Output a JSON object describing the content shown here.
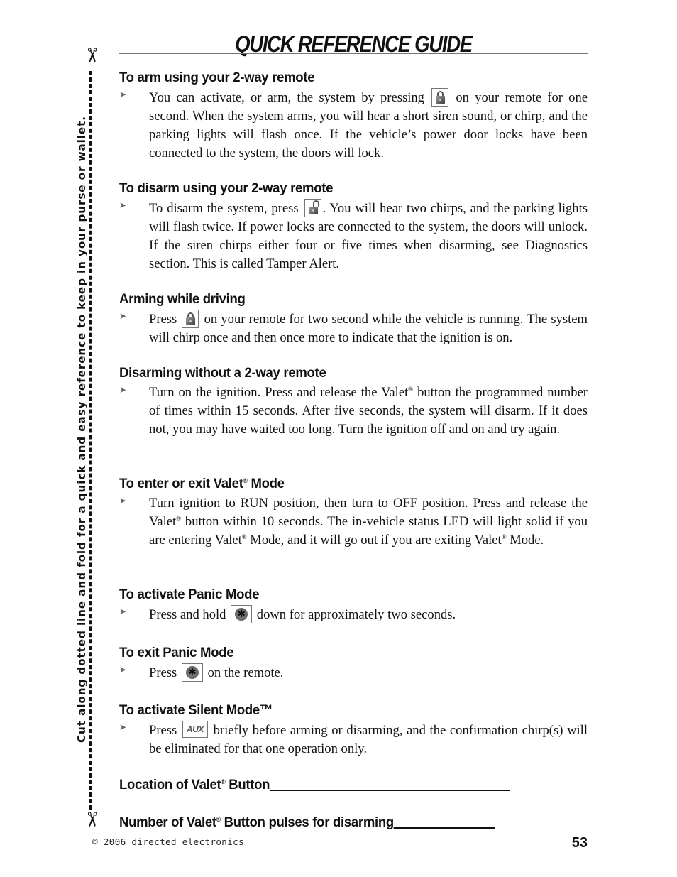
{
  "title": "QUICK REFERENCE GUIDE",
  "side_instruction": "Cut along dotted line and fold for a quick and easy reference to keep in your purse or wallet.",
  "icons": {
    "lock": "lock-button",
    "unlock": "unlock-button",
    "panic": "panic-button",
    "aux": "aux-button",
    "aux_label": "AUX",
    "scissors": "✂",
    "bullet": "➤",
    "panic_glyph": "✱",
    "registered": "®"
  },
  "sections": [
    {
      "heading": "To arm using your 2-way remote",
      "text_before": "You can activate, or arm, the system by pressing",
      "text_after": "on your remote for one second. When the system arms, you will hear a short siren sound, or chirp, and the parking lights will flash once. If the vehicle’s power door locks have been connected to the system, the doors will lock."
    },
    {
      "heading": "To disarm using your 2-way remote",
      "text_before": "To disarm the system, press",
      "text_after": ". You will hear two chirps, and the parking lights will flash twice. If power locks are connected to the system, the doors will unlock. If the siren chirps either four or five times when disarming, see Diagnostics section. This is called Tamper Alert."
    },
    {
      "heading": "Arming while driving",
      "text_before": "Press",
      "text_after": "on your remote for two second while the vehicle is running. The system will chirp once and then once more to indicate that the ignition is on."
    },
    {
      "heading": "Disarming without a 2-way remote",
      "text_a": "Turn on the ignition. Press and release the Valet",
      "text_b": " button the programmed number of times within 15 seconds. After five seconds, the system will disarm. If it does not, you may have waited too long. Turn the ignition off and on and try again."
    },
    {
      "heading_a": "To enter or exit Valet",
      "heading_b": " Mode",
      "text_a": "Turn ignition to RUN position, then turn to OFF position. Press and release the Valet",
      "text_b": " button within 10 seconds. The in-vehicle status LED will light solid if you are entering Valet",
      "text_c": " Mode, and it will go out if you are exiting Valet",
      "text_d": " Mode."
    },
    {
      "heading": "To activate Panic Mode",
      "text_before": "Press and hold",
      "text_after": "down for approximately two seconds."
    },
    {
      "heading": "To exit Panic Mode",
      "text_before": "Press",
      "text_after": "on the remote."
    },
    {
      "heading": "To activate Silent Mode™",
      "text_before": "Press",
      "text_after": "briefly before arming or disarming, and the confirmation chirp(s) will be eliminated for that one operation only."
    }
  ],
  "fill_in": [
    {
      "label_a": "Location of Valet",
      "label_b": " Button",
      "value": ""
    },
    {
      "label_a": "Number of Valet",
      "label_b": " Button pulses for disarming",
      "value": ""
    }
  ],
  "footer": {
    "copyright": "© 2006 directed electronics",
    "page_number": "53"
  }
}
